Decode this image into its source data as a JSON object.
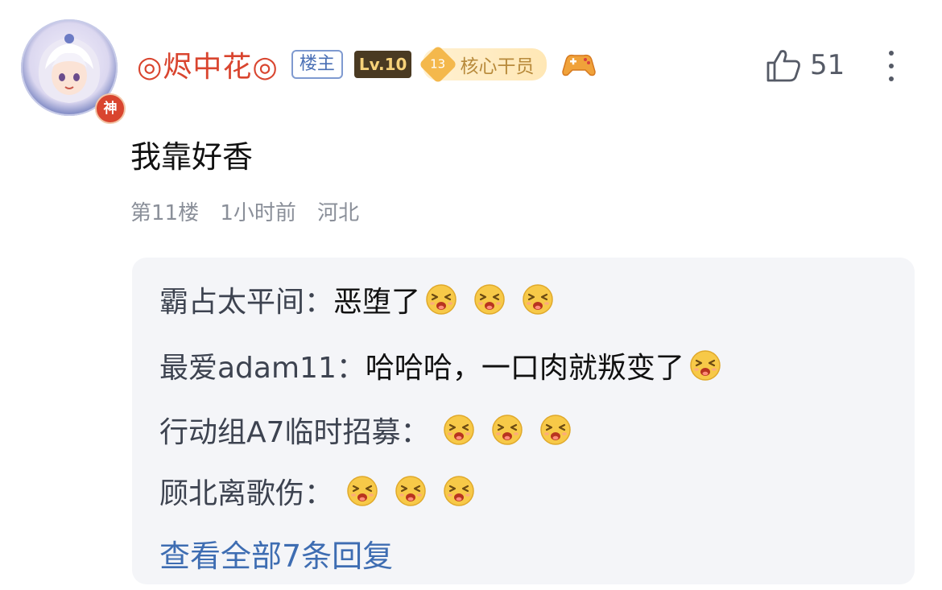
{
  "user": {
    "username": "◎烬中花◎",
    "host_tag": "楼主",
    "level": "Lv.10",
    "core_badge_number": "13",
    "core_badge_label": "核心干员",
    "avatar_badge": "神",
    "avatar_icon": "anime-avatar-icon",
    "gamepad_icon": "gamepad-icon"
  },
  "likes": {
    "count": "51",
    "icon": "thumbs-up-icon"
  },
  "more_icon": "vertical-ellipsis-icon",
  "post": {
    "content": "我靠好香",
    "floor": "第11楼",
    "time": "1小时前",
    "location": "河北"
  },
  "replies": [
    {
      "author": "霸占太平间：",
      "text": "恶堕了",
      "emoji_count": 3,
      "emoji": "laughing-face-emoji"
    },
    {
      "author": "最爱adam11：",
      "text": "哈哈哈，一口肉就叛变了",
      "emoji_count": 1,
      "emoji": "laughing-face-emoji"
    },
    {
      "author": "行动组A7临时招募：",
      "text": "",
      "emoji_count": 3,
      "emoji": "laughing-face-emoji"
    },
    {
      "author": "顾北离歌伤：",
      "text": "",
      "emoji_count": 3,
      "emoji": "laughing-face-emoji"
    }
  ],
  "view_all_label": "查看全部7条回复",
  "colors": {
    "username": "#d9452f",
    "link": "#3e6db2",
    "meta": "#8a8f99",
    "reply_bg": "#f4f5f8"
  }
}
